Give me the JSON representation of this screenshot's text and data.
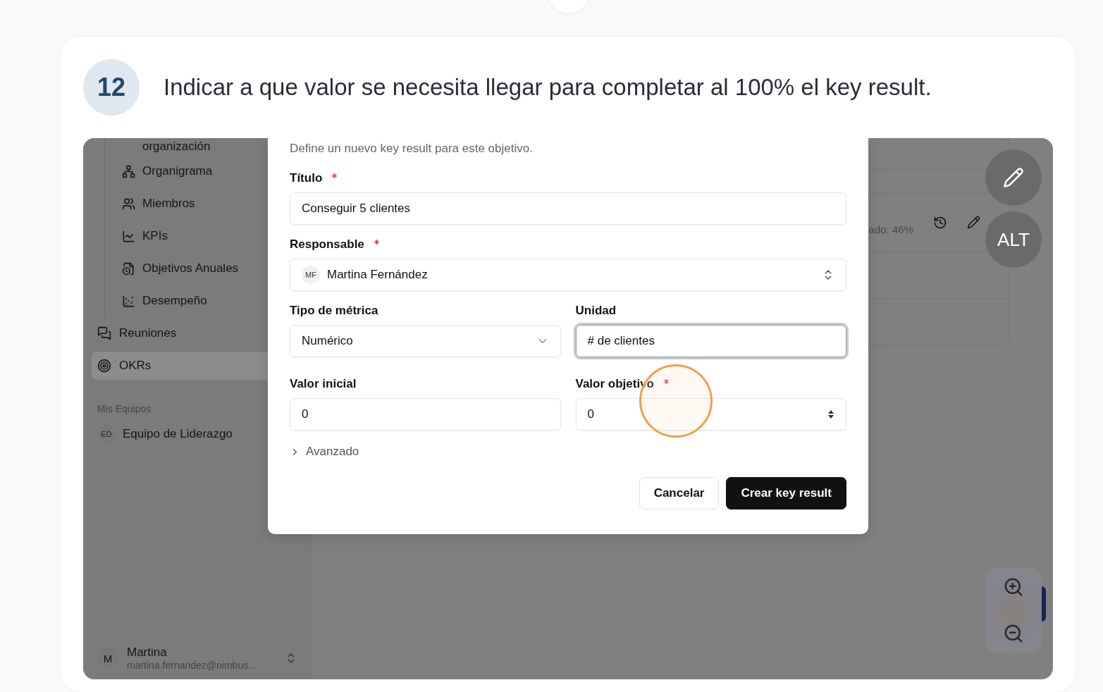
{
  "step": {
    "number": "12",
    "instruction": "Indicar a que valor se necesita llegar para completar al 100% el key result."
  },
  "sidebar": {
    "sub_items": [
      {
        "label": "organización"
      },
      {
        "label": "Organigrama"
      },
      {
        "label": "Miembros"
      },
      {
        "label": "KPIs"
      },
      {
        "label": "Objetivos Anuales"
      },
      {
        "label": "Desempeño"
      }
    ],
    "items": [
      {
        "label": "Reuniones",
        "selected": false
      },
      {
        "label": "OKRs",
        "selected": true
      }
    ],
    "teams_heading": "Mis Equipos",
    "teams": [
      {
        "initials": "ED",
        "name": "Equipo de Liderazgo"
      }
    ],
    "user": {
      "initial": "M",
      "name": "Martina",
      "email": "martina.fernandez@nimbus..."
    }
  },
  "background": {
    "progress_text": "ado: 46%"
  },
  "dialog": {
    "description": "Define un nuevo key result para este objetivo.",
    "rows": [
      [
        {
          "kind": "text",
          "label": "Título",
          "required": true,
          "value": "Conseguir 5 clientes",
          "focused": false,
          "highlighted": false
        }
      ],
      [
        {
          "kind": "person",
          "label": "Responsable",
          "required": true,
          "initials": "MF",
          "value": "Martina Fernández",
          "focused": false,
          "highlighted": false
        }
      ],
      [
        {
          "kind": "select",
          "label": "Tipo de métrica",
          "required": false,
          "value": "Numérico",
          "focused": false,
          "highlighted": false
        },
        {
          "kind": "text",
          "label": "Unidad",
          "required": false,
          "value": "# de clientes",
          "focused": true,
          "highlighted": false
        }
      ],
      [
        {
          "kind": "text",
          "label": "Valor inicial",
          "required": false,
          "value": "0",
          "focused": false,
          "highlighted": false
        },
        {
          "kind": "number",
          "label": "Valor objetivo",
          "required": true,
          "value": "0",
          "focused": false,
          "highlighted": true
        }
      ]
    ],
    "advanced": {
      "label": "Avanzado",
      "expanded": false
    },
    "buttons": [
      {
        "kind": "secondary",
        "label": "Cancelar"
      },
      {
        "kind": "primary",
        "label": "Crear key result"
      }
    ]
  },
  "floating": {
    "alt_label": "ALT"
  }
}
